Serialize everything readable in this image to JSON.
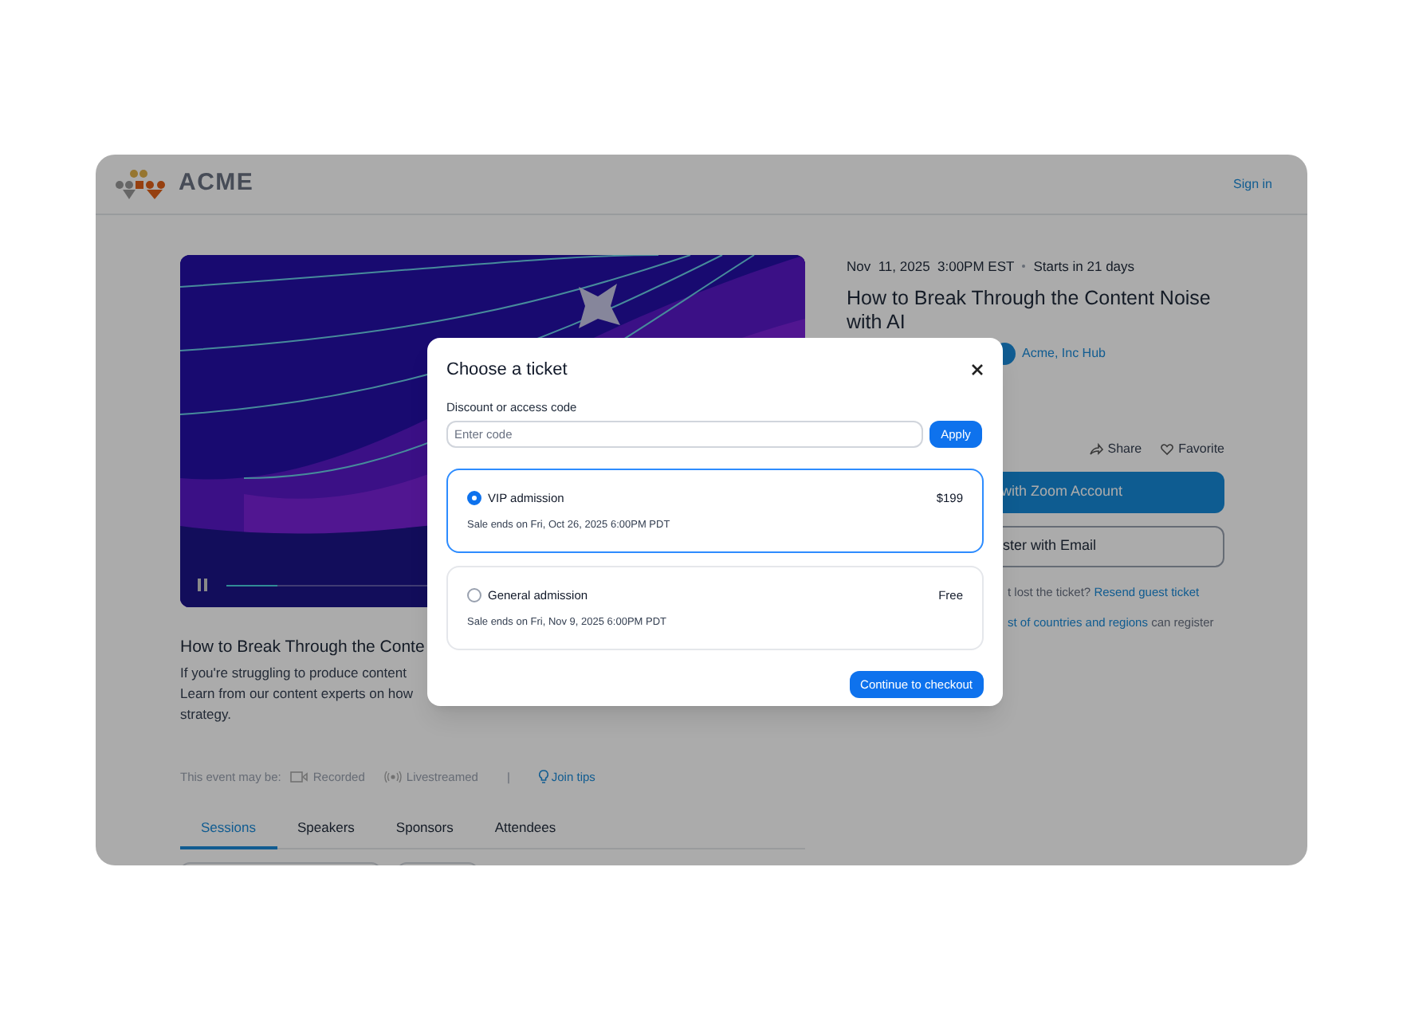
{
  "header": {
    "logo_text": "ACME",
    "sign_in": "Sign in"
  },
  "video": {
    "level": 0.09
  },
  "event": {
    "date": "Nov  11, 2025  3:00PM EST",
    "countdown": "Starts in 21 days",
    "title": "How to Break Through the Content Noise with AI",
    "host": "Acme, Inc Hub",
    "actions": [
      "Share",
      "Favorite"
    ],
    "register_buttons": [
      {
        "label": "with Zoom Account",
        "kind": "primary"
      },
      {
        "label": "ster with Email",
        "kind": "outline"
      }
    ],
    "lost_ticket": {
      "text": "t lost the ticket?",
      "link": "Resend guest ticket"
    },
    "countries": {
      "link": "st of countries and regions",
      "text": "can register"
    }
  },
  "about": {
    "title": "How to Break Through the Conte",
    "lines": [
      "If you're struggling to produce content",
      "Learn from our content experts on how",
      "strategy."
    ]
  },
  "meta": {
    "prefix": "This event may be:",
    "items": [
      {
        "kind": "recorded",
        "label": "Recorded"
      },
      {
        "kind": "livestreamed",
        "label": "Livestreamed"
      }
    ],
    "separator": "|",
    "tips": "Join tips"
  },
  "tabs": [
    {
      "label": "Sessions",
      "selected": true
    },
    {
      "label": "Speakers",
      "selected": false
    },
    {
      "label": "Sponsors",
      "selected": false
    },
    {
      "label": "Attendees",
      "selected": false
    }
  ],
  "modal": {
    "title": "Choose a ticket",
    "code_label": "Discount or access code",
    "code_placeholder": "Enter code",
    "apply": "Apply",
    "tickets": [
      {
        "name": "VIP admission",
        "price": "$199",
        "sale_ends": "Sale ends on Fri, Oct 26, 2025 6:00PM PDT",
        "selected": true
      },
      {
        "name": "General admission",
        "price": "Free",
        "sale_ends": "Sale ends on Fri, Nov 9, 2025 6:00PM PDT",
        "selected": false
      }
    ],
    "continue": "Continue to checkout"
  }
}
